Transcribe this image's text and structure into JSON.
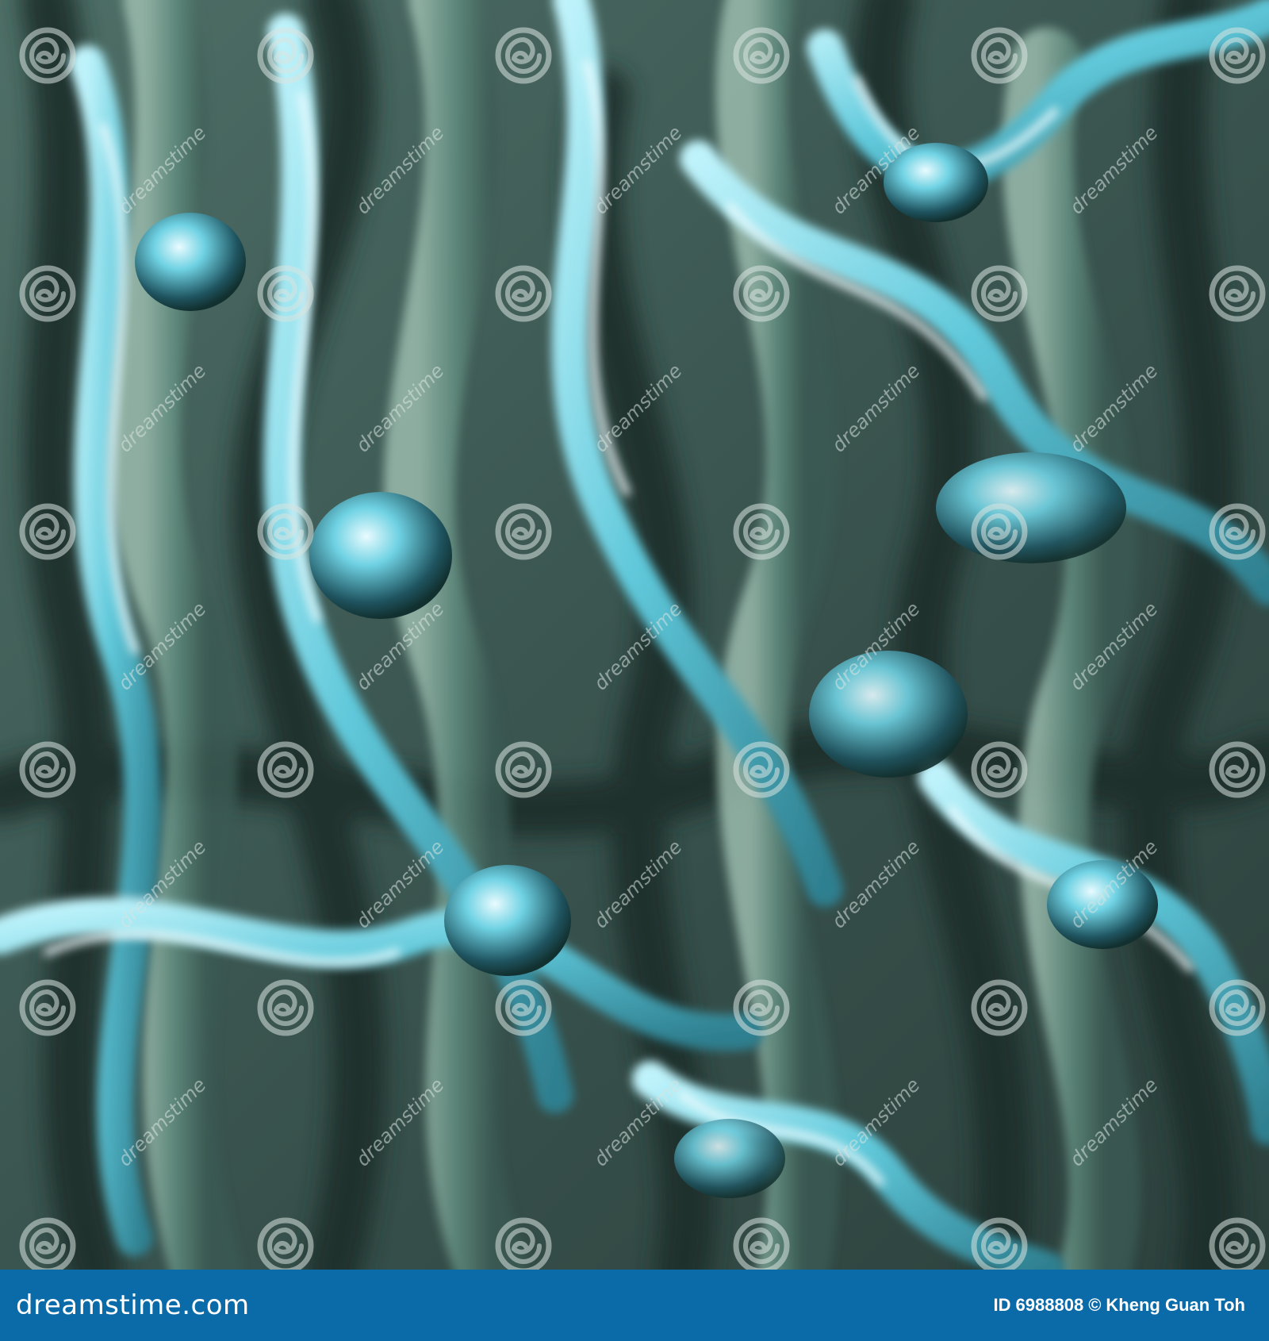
{
  "image": {
    "subject": "abstract liquid chrome / metallic texture",
    "palette": {
      "dark_shadow": "#243532",
      "mid_green": "#5f8a7f",
      "light_green": "#8fb3a6",
      "cyan_highlight": "#7fe3f0",
      "ice_blue": "#bff3fb",
      "white_specular": "#f2fdff"
    }
  },
  "watermark": {
    "text": "dreamstime",
    "logo_icon": "spiral-logo-icon"
  },
  "footer": {
    "background_color": "#0b6aa8",
    "brand_label": "dreamstime.com",
    "id_label": "ID",
    "id_value": "6988808",
    "copyright_symbol": "©",
    "author": "Kheng Guan Toh"
  }
}
